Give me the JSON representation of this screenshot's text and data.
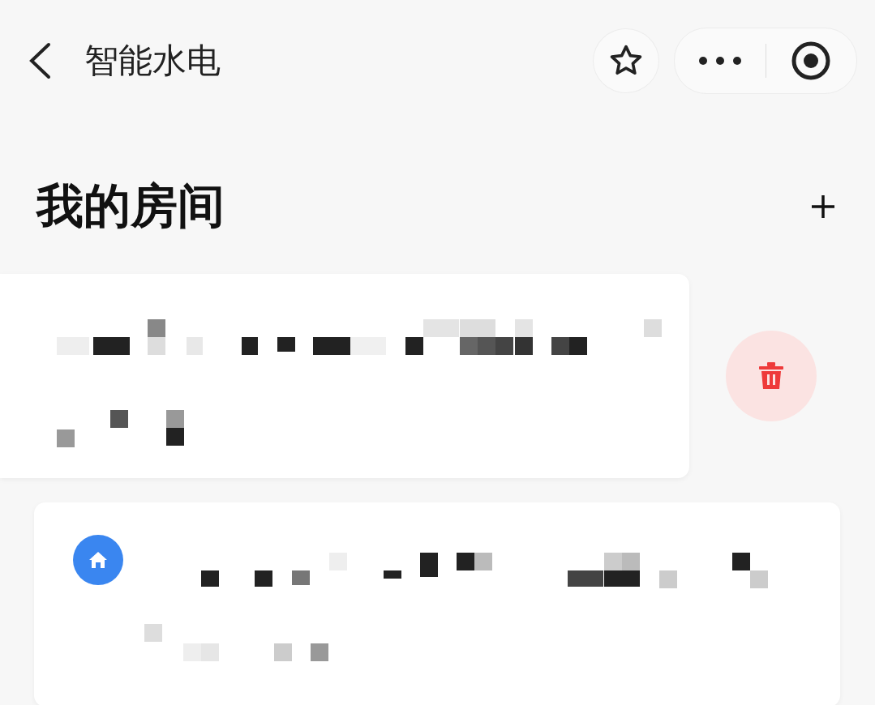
{
  "nav": {
    "title": "智能水电"
  },
  "section": {
    "title": "我的房间"
  },
  "rooms": [
    {
      "swiped": true
    },
    {
      "swiped": false
    }
  ]
}
